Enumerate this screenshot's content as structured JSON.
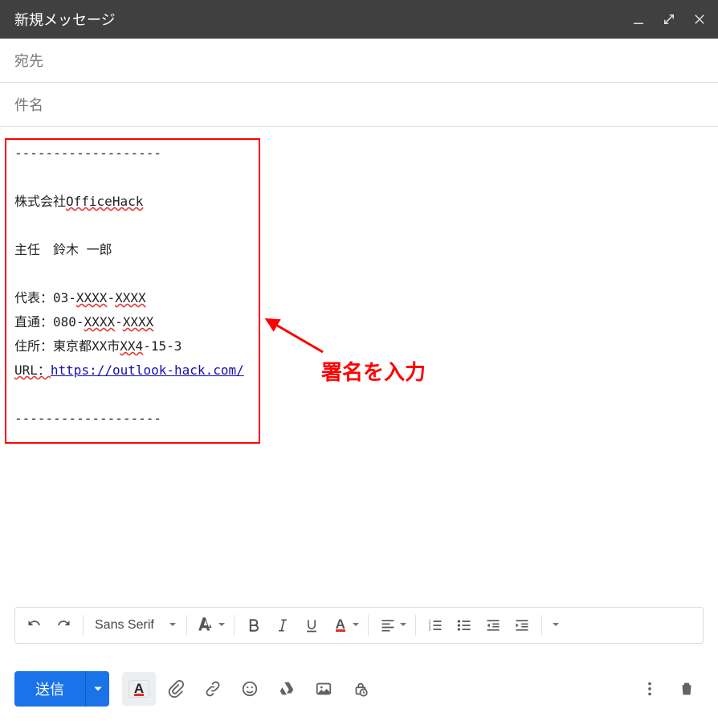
{
  "window": {
    "title": "新規メッセージ"
  },
  "fields": {
    "to_placeholder": "宛先",
    "subject_placeholder": "件名"
  },
  "signature": {
    "divider_top": "-------------------",
    "company": "株式会社",
    "company_suffix": "OfficeHack",
    "role_line": "主任　鈴木 一郎",
    "phone_rep_label": "代表：03-",
    "phone_rep_x1": "XXXX",
    "phone_rep_dash": "-",
    "phone_rep_x2": "XXXX",
    "phone_dir_label": "直通：080-",
    "phone_dir_x1": "XXXX",
    "phone_dir_dash": "-",
    "phone_dir_x2": "XXXX",
    "addr_label": "住所：東京都XX市",
    "addr_span": "XX4",
    "addr_suffix": "-15-3",
    "url_label": "URL：",
    "url_value": "https://outlook-hack.com/",
    "divider_bottom": "-------------------"
  },
  "annotation": {
    "label": "署名を入力"
  },
  "format_toolbar": {
    "font_name": "Sans Serif"
  },
  "actions": {
    "send_label": "送信"
  }
}
